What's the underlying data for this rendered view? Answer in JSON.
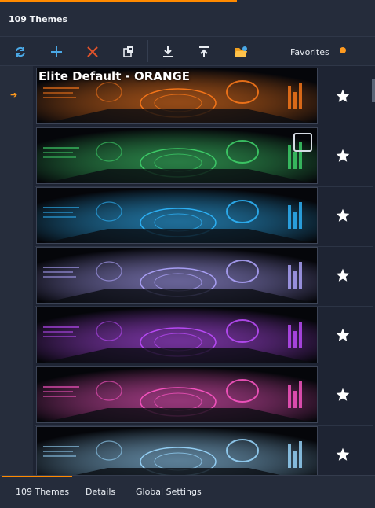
{
  "header": {
    "title": "109 Themes"
  },
  "toolbar": {
    "buttons": [
      {
        "name": "refresh-button",
        "icon": "refresh-icon"
      },
      {
        "name": "add-button",
        "icon": "plus-icon"
      },
      {
        "name": "delete-button",
        "icon": "close-icon"
      },
      {
        "name": "copy-button",
        "icon": "copy-icon"
      },
      {
        "name": "import-button",
        "icon": "download-icon"
      },
      {
        "name": "export-button",
        "icon": "upload-icon"
      },
      {
        "name": "open-folder-button",
        "icon": "folder-icon"
      }
    ],
    "favorites_label": "Favorites",
    "favorites_enabled": false
  },
  "list": {
    "selected_index": 0,
    "selected_marker": "➔",
    "themes": [
      {
        "name": "Elite Default - ORANGE",
        "favorite_icon": "star-icon",
        "accent": "#ff7a1a"
      },
      {
        "name": "",
        "favorite_icon": "star-icon",
        "accent": "#3fd36b"
      },
      {
        "name": "",
        "favorite_icon": "star-icon",
        "accent": "#2fb8ff"
      },
      {
        "name": "",
        "favorite_icon": "star-icon",
        "accent": "#b0a6ff"
      },
      {
        "name": "",
        "favorite_icon": "star-icon",
        "accent": "#c04dff"
      },
      {
        "name": "",
        "favorite_icon": "star-icon",
        "accent": "#ff57c8"
      },
      {
        "name": "",
        "favorite_icon": "star-icon",
        "accent": "#9ad8ff"
      }
    ]
  },
  "bottom_tabs": [
    {
      "label": "109 Themes",
      "active": true
    },
    {
      "label": "Details",
      "active": false
    },
    {
      "label": "Global Settings",
      "active": false
    }
  ],
  "colors": {
    "accent": "#ff8a00",
    "background": "#1e2433",
    "panel": "#252c3b"
  }
}
